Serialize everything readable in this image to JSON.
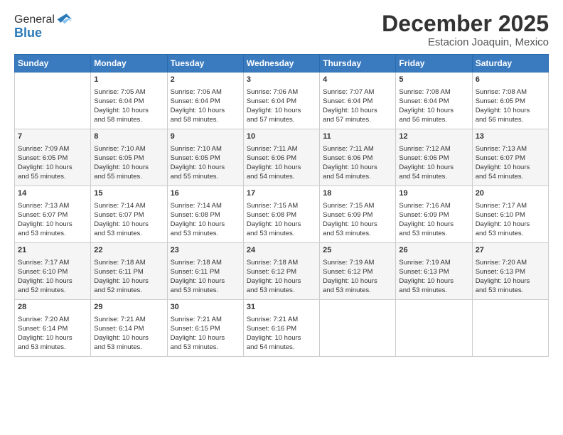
{
  "logo": {
    "line1": "General",
    "line2": "Blue"
  },
  "title": "December 2025",
  "subtitle": "Estacion Joaquin, Mexico",
  "headers": [
    "Sunday",
    "Monday",
    "Tuesday",
    "Wednesday",
    "Thursday",
    "Friday",
    "Saturday"
  ],
  "weeks": [
    [
      {
        "day": "",
        "info": ""
      },
      {
        "day": "1",
        "info": "Sunrise: 7:05 AM\nSunset: 6:04 PM\nDaylight: 10 hours\nand 58 minutes."
      },
      {
        "day": "2",
        "info": "Sunrise: 7:06 AM\nSunset: 6:04 PM\nDaylight: 10 hours\nand 58 minutes."
      },
      {
        "day": "3",
        "info": "Sunrise: 7:06 AM\nSunset: 6:04 PM\nDaylight: 10 hours\nand 57 minutes."
      },
      {
        "day": "4",
        "info": "Sunrise: 7:07 AM\nSunset: 6:04 PM\nDaylight: 10 hours\nand 57 minutes."
      },
      {
        "day": "5",
        "info": "Sunrise: 7:08 AM\nSunset: 6:04 PM\nDaylight: 10 hours\nand 56 minutes."
      },
      {
        "day": "6",
        "info": "Sunrise: 7:08 AM\nSunset: 6:05 PM\nDaylight: 10 hours\nand 56 minutes."
      }
    ],
    [
      {
        "day": "7",
        "info": "Sunrise: 7:09 AM\nSunset: 6:05 PM\nDaylight: 10 hours\nand 55 minutes."
      },
      {
        "day": "8",
        "info": "Sunrise: 7:10 AM\nSunset: 6:05 PM\nDaylight: 10 hours\nand 55 minutes."
      },
      {
        "day": "9",
        "info": "Sunrise: 7:10 AM\nSunset: 6:05 PM\nDaylight: 10 hours\nand 55 minutes."
      },
      {
        "day": "10",
        "info": "Sunrise: 7:11 AM\nSunset: 6:06 PM\nDaylight: 10 hours\nand 54 minutes."
      },
      {
        "day": "11",
        "info": "Sunrise: 7:11 AM\nSunset: 6:06 PM\nDaylight: 10 hours\nand 54 minutes."
      },
      {
        "day": "12",
        "info": "Sunrise: 7:12 AM\nSunset: 6:06 PM\nDaylight: 10 hours\nand 54 minutes."
      },
      {
        "day": "13",
        "info": "Sunrise: 7:13 AM\nSunset: 6:07 PM\nDaylight: 10 hours\nand 54 minutes."
      }
    ],
    [
      {
        "day": "14",
        "info": "Sunrise: 7:13 AM\nSunset: 6:07 PM\nDaylight: 10 hours\nand 53 minutes."
      },
      {
        "day": "15",
        "info": "Sunrise: 7:14 AM\nSunset: 6:07 PM\nDaylight: 10 hours\nand 53 minutes."
      },
      {
        "day": "16",
        "info": "Sunrise: 7:14 AM\nSunset: 6:08 PM\nDaylight: 10 hours\nand 53 minutes."
      },
      {
        "day": "17",
        "info": "Sunrise: 7:15 AM\nSunset: 6:08 PM\nDaylight: 10 hours\nand 53 minutes."
      },
      {
        "day": "18",
        "info": "Sunrise: 7:15 AM\nSunset: 6:09 PM\nDaylight: 10 hours\nand 53 minutes."
      },
      {
        "day": "19",
        "info": "Sunrise: 7:16 AM\nSunset: 6:09 PM\nDaylight: 10 hours\nand 53 minutes."
      },
      {
        "day": "20",
        "info": "Sunrise: 7:17 AM\nSunset: 6:10 PM\nDaylight: 10 hours\nand 53 minutes."
      }
    ],
    [
      {
        "day": "21",
        "info": "Sunrise: 7:17 AM\nSunset: 6:10 PM\nDaylight: 10 hours\nand 52 minutes."
      },
      {
        "day": "22",
        "info": "Sunrise: 7:18 AM\nSunset: 6:11 PM\nDaylight: 10 hours\nand 52 minutes."
      },
      {
        "day": "23",
        "info": "Sunrise: 7:18 AM\nSunset: 6:11 PM\nDaylight: 10 hours\nand 53 minutes."
      },
      {
        "day": "24",
        "info": "Sunrise: 7:18 AM\nSunset: 6:12 PM\nDaylight: 10 hours\nand 53 minutes."
      },
      {
        "day": "25",
        "info": "Sunrise: 7:19 AM\nSunset: 6:12 PM\nDaylight: 10 hours\nand 53 minutes."
      },
      {
        "day": "26",
        "info": "Sunrise: 7:19 AM\nSunset: 6:13 PM\nDaylight: 10 hours\nand 53 minutes."
      },
      {
        "day": "27",
        "info": "Sunrise: 7:20 AM\nSunset: 6:13 PM\nDaylight: 10 hours\nand 53 minutes."
      }
    ],
    [
      {
        "day": "28",
        "info": "Sunrise: 7:20 AM\nSunset: 6:14 PM\nDaylight: 10 hours\nand 53 minutes."
      },
      {
        "day": "29",
        "info": "Sunrise: 7:21 AM\nSunset: 6:14 PM\nDaylight: 10 hours\nand 53 minutes."
      },
      {
        "day": "30",
        "info": "Sunrise: 7:21 AM\nSunset: 6:15 PM\nDaylight: 10 hours\nand 53 minutes."
      },
      {
        "day": "31",
        "info": "Sunrise: 7:21 AM\nSunset: 6:16 PM\nDaylight: 10 hours\nand 54 minutes."
      },
      {
        "day": "",
        "info": ""
      },
      {
        "day": "",
        "info": ""
      },
      {
        "day": "",
        "info": ""
      }
    ]
  ]
}
